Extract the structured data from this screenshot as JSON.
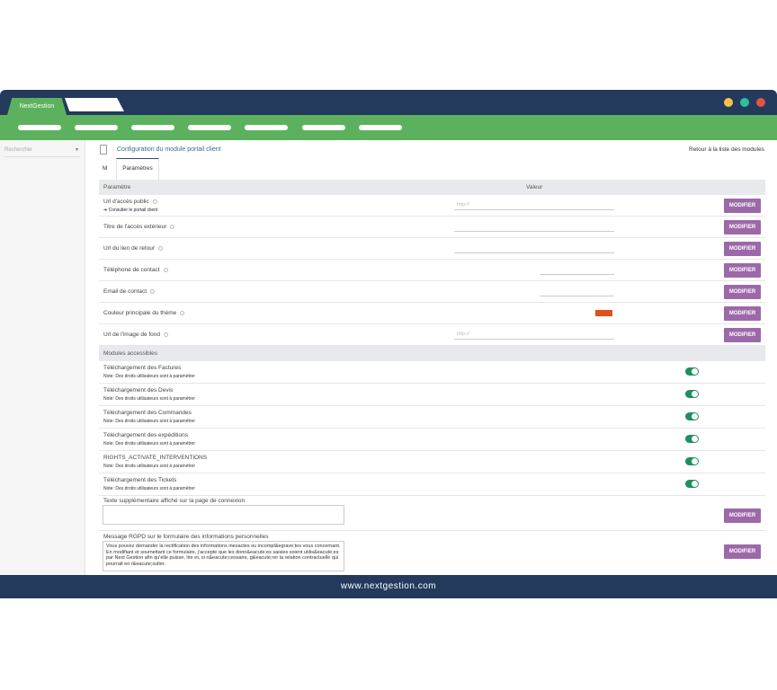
{
  "app": {
    "brand": "NextGestion",
    "footer": "www.nextgestion.com",
    "colors": {
      "header": "#233a5c",
      "menu": "#5cb15e",
      "button": "#9c69a8",
      "toggle": "#1f8f5f",
      "theme_swatch": "#e0501c"
    }
  },
  "window_controls": [
    "minimize",
    "maximize",
    "close"
  ],
  "sidebar": {
    "search_placeholder": "Rechercher"
  },
  "page": {
    "title": "Configuration du module portail client",
    "back_link": "Retour à la liste des modules",
    "tab_short": "M",
    "tab_active": "Paramètres"
  },
  "table": {
    "col_param": "Paramètre",
    "col_value": "Valeur",
    "button": "MODIFIER",
    "params": [
      {
        "label": "Url d'accès public",
        "sub": "➔ Consulter le portail client",
        "value_placeholder": "http://"
      },
      {
        "label": "Titre de l'accès extérieur",
        "value_placeholder": ""
      },
      {
        "label": "Url du lien de retour",
        "value_placeholder": ""
      },
      {
        "label": "Téléphone de contact",
        "value_placeholder": ""
      },
      {
        "label": "Email de contact",
        "value_placeholder": ""
      },
      {
        "label": "Couleur principale du thème",
        "value": "#e0501c"
      },
      {
        "label": "Url de l'image de fond",
        "value_placeholder": "http://"
      }
    ],
    "modules_header": "Modules accessibles",
    "modules": [
      {
        "label": "Téléchargement des Factures",
        "note": "Note: Des droits utilisateurs sont à paramétrer",
        "enabled": true
      },
      {
        "label": "Téléchargement des Devis",
        "note": "Note: Des droits utilisateurs sont à paramétrer",
        "enabled": true
      },
      {
        "label": "Téléchargement des Commandes",
        "note": "Note: Des droits utilisateurs sont à paramétrer",
        "enabled": true
      },
      {
        "label": "Téléchargement des expéditions",
        "note": "Note: Des droits utilisateurs sont à paramétrer",
        "enabled": true
      },
      {
        "label": "RIGHTS_ACTIVATE_INTERVENTIONS",
        "note": "Note: Des droits utilisateurs sont à paramétrer",
        "enabled": true
      },
      {
        "label": "Téléchargement des Tickets",
        "note": "Note: Des droits utilisateurs sont à paramétrer",
        "enabled": true
      }
    ],
    "extra_text": {
      "label": "Texte supplémentaire affiché sur la page de connexion",
      "value": ""
    },
    "rgpd": {
      "label": "Message RGPD sur le formulaire des informations personnelles",
      "value": "Vous pouvez demander la rectification des informations inexactes ou incompl&egrave;tes vous concernant. En modifiant et soumettant ce formulaire, j'accepte que les donn&eacute;es saisies soient utilis&eacute;es par Next Gestion afin qu'elle puisse, lire et, si n&eacute;cessaire, g&eacute;rer la relation contractuelle qui pourrait en r&eacute;sulter."
    }
  }
}
